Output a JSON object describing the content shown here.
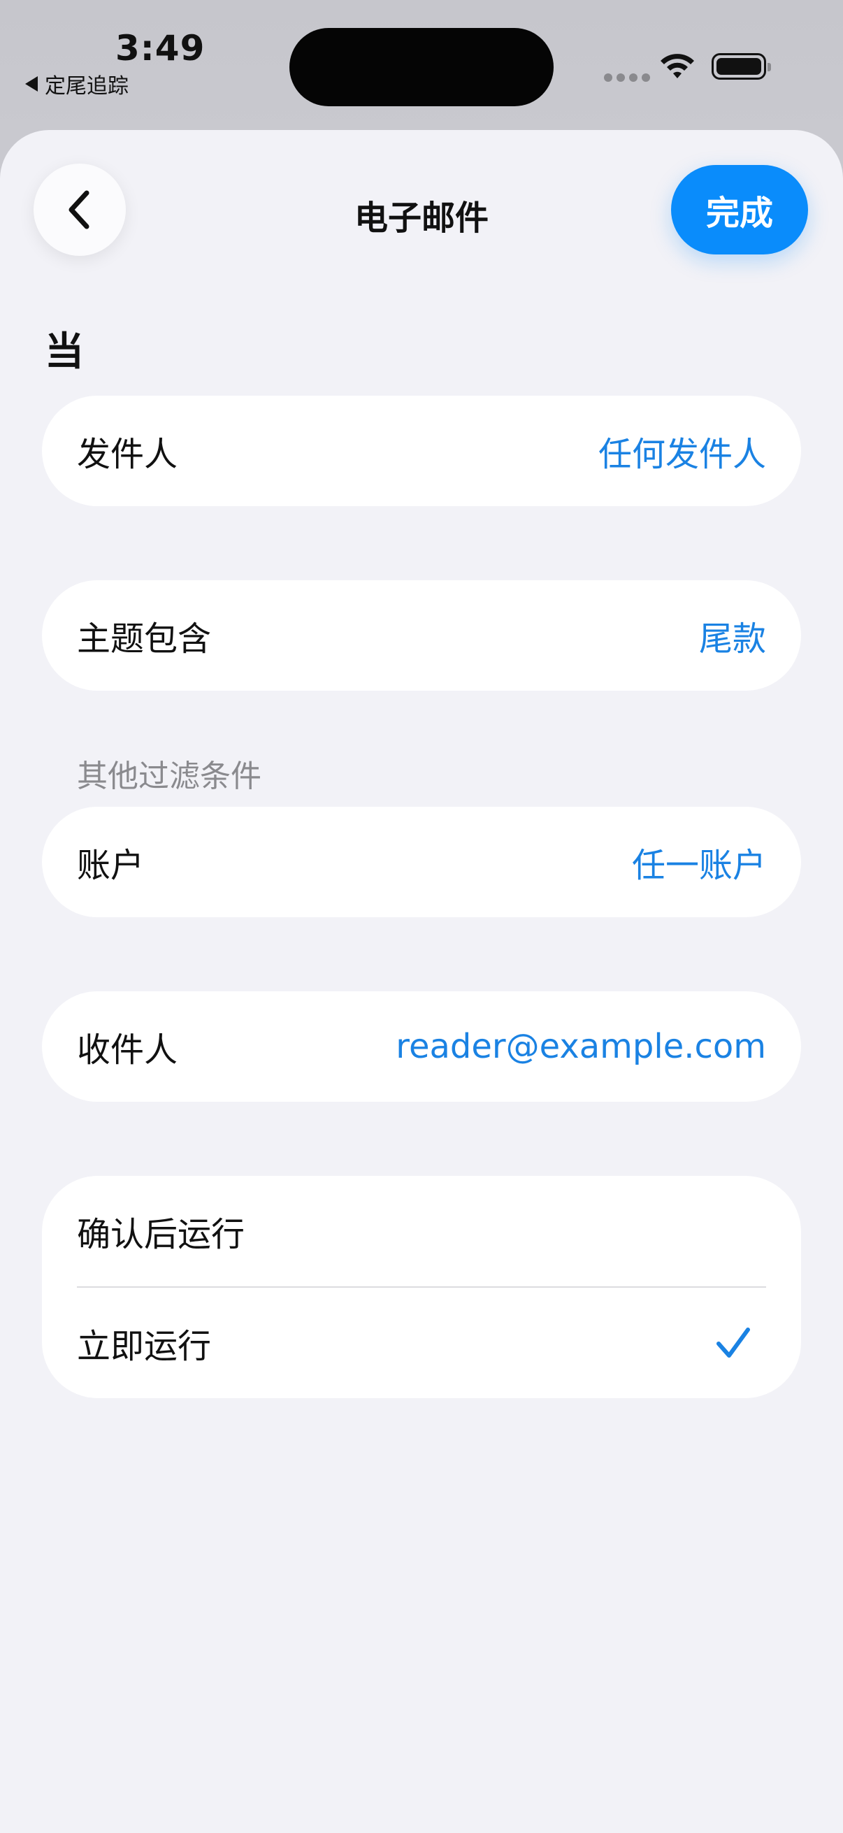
{
  "status_bar": {
    "time": "3:49",
    "back_app": "定尾追踪"
  },
  "nav": {
    "title": "电子邮件",
    "done_label": "完成"
  },
  "section": {
    "heading": "当"
  },
  "rows": {
    "sender": {
      "label": "发件人",
      "value": "任何发件人"
    },
    "subject": {
      "label": "主题包含",
      "value": "尾款"
    },
    "account": {
      "label": "账户",
      "value": "任一账户"
    },
    "recipient": {
      "label": "收件人",
      "value": "reader@example.com"
    }
  },
  "filters": {
    "label": "其他过滤条件"
  },
  "run_options": [
    {
      "label": "确认后运行",
      "selected": false
    },
    {
      "label": "立即运行",
      "selected": true
    }
  ],
  "colors": {
    "accent": "#0a8cfb",
    "value_text": "#1a82e3",
    "background": "#f2f2f7",
    "card": "#ffffff"
  }
}
